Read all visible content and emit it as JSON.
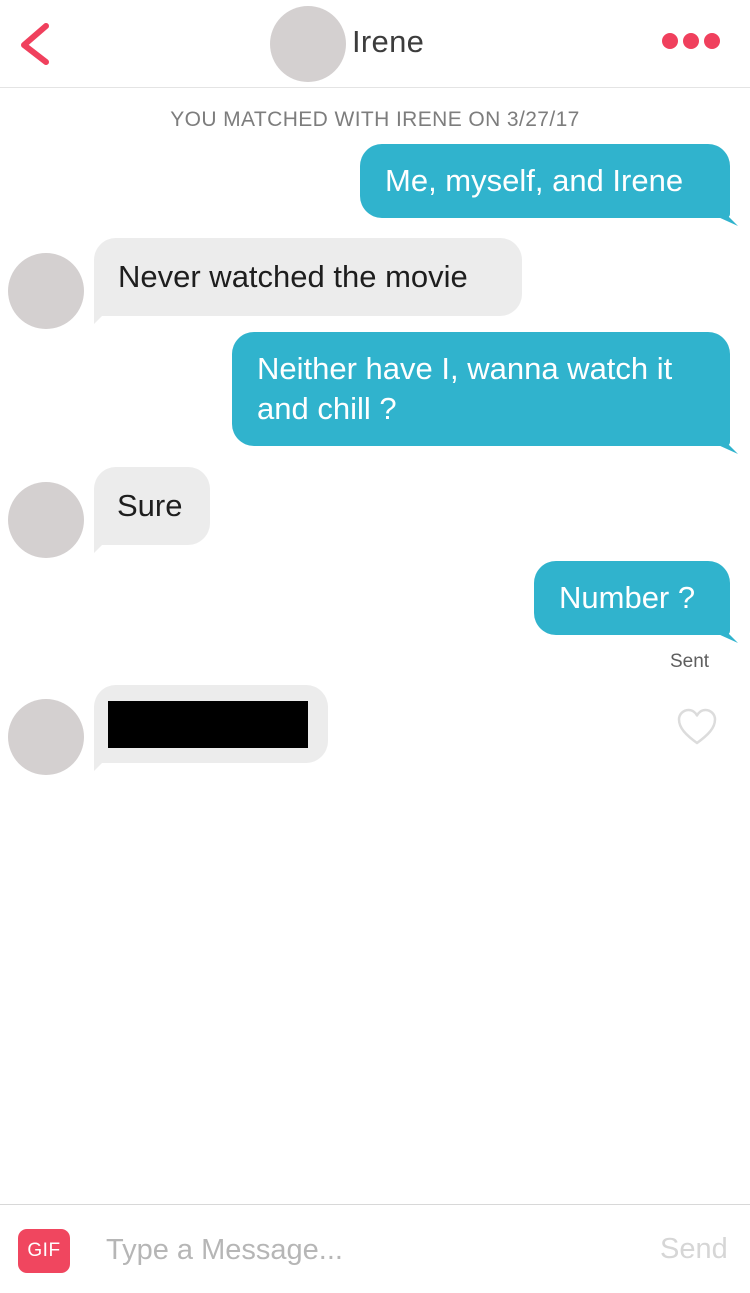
{
  "header": {
    "contact_name": "Irene",
    "back_icon": "chevron-left-icon",
    "more_icon": "more-dots-icon",
    "accent_color": "#f0405d"
  },
  "match_banner": "YOU MATCHED WITH IRENE ON 3/27/17",
  "messages": [
    {
      "direction": "outgoing",
      "text": "Me, myself, and Irene"
    },
    {
      "direction": "incoming",
      "text": "Never watched the movie"
    },
    {
      "direction": "outgoing",
      "text": "Neither have I, wanna watch it and chill ?"
    },
    {
      "direction": "incoming",
      "text": "Sure"
    },
    {
      "direction": "outgoing",
      "text": "Number ?"
    },
    {
      "direction": "incoming",
      "text": "",
      "redacted": true
    }
  ],
  "status": {
    "sent_label": "Sent"
  },
  "like_icon": "heart-outline-icon",
  "composer": {
    "gif_label": "GIF",
    "placeholder": "Type a Message...",
    "value": "",
    "send_label": "Send"
  },
  "colors": {
    "outgoing_bubble": "#30b3cd",
    "incoming_bubble": "#ececec",
    "gif_button": "#f0465f"
  }
}
